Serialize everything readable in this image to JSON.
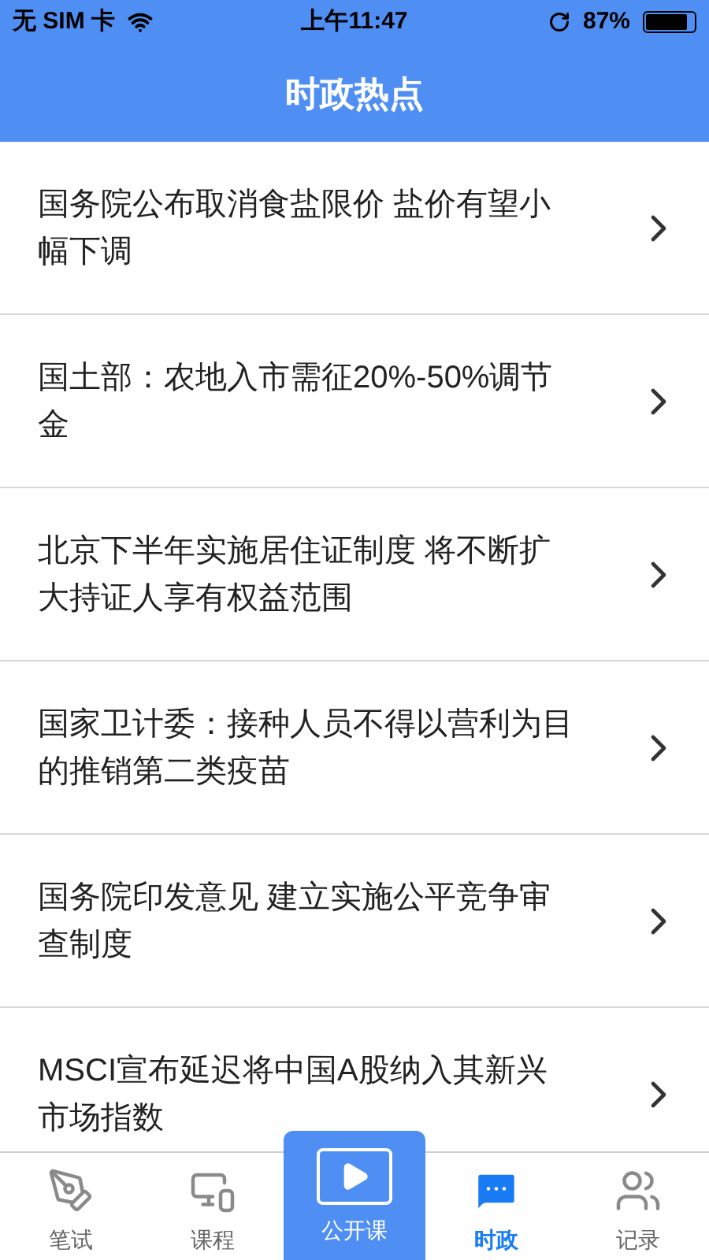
{
  "status_bar": {
    "carrier": "无 SIM 卡",
    "time": "上午11:47",
    "battery": "87%"
  },
  "header": {
    "title": "时政热点"
  },
  "news": [
    {
      "title": "国务院公布取消食盐限价 盐价有望小幅下调"
    },
    {
      "title": "国土部：农地入市需征20%-50%调节金"
    },
    {
      "title": "北京下半年实施居住证制度 将不断扩大持证人享有权益范围"
    },
    {
      "title": "国家卫计委：接种人员不得以营利为目的推销第二类疫苗"
    },
    {
      "title": "国务院印发意见 建立实施公平竞争审查制度"
    },
    {
      "title": "MSCI宣布延迟将中国A股纳入其新兴市场指数"
    }
  ],
  "tab_bar": [
    {
      "label": "笔试",
      "kind": "normal",
      "selected": false
    },
    {
      "label": "课程",
      "kind": "normal",
      "selected": false
    },
    {
      "label": "公开课",
      "kind": "featured",
      "selected": false
    },
    {
      "label": "时政",
      "kind": "normal",
      "selected": true
    },
    {
      "label": "记录",
      "kind": "normal",
      "selected": false
    }
  ]
}
